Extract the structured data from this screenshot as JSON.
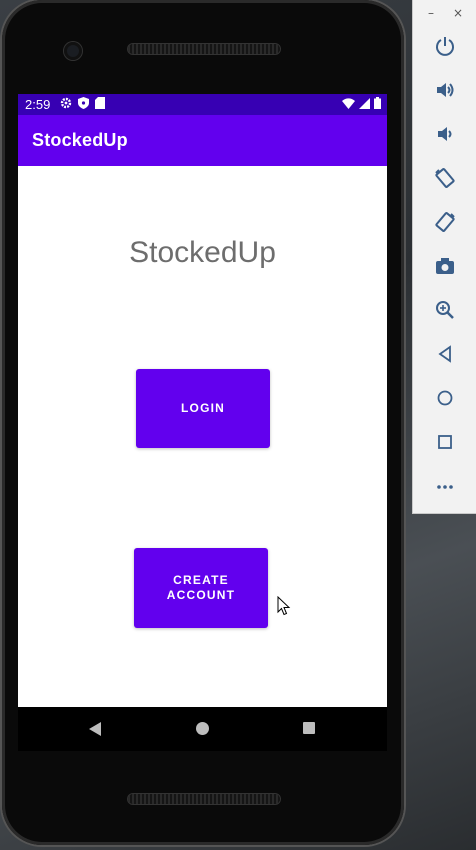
{
  "status_bar": {
    "time": "2:59"
  },
  "app_bar": {
    "title": "StockedUp"
  },
  "main": {
    "app_name": "StockedUp",
    "login_label": "LOGIN",
    "create_label_line1": "CREATE",
    "create_label_line2": "ACCOUNT"
  },
  "colors": {
    "primary": "#6200ee",
    "primary_dark": "#3700b3",
    "text_gray": "#6d6d6d"
  },
  "emulator_panel": {
    "window_controls": [
      "–",
      "×"
    ],
    "tools": [
      "power-icon",
      "volume-up-icon",
      "volume-down-icon",
      "rotate-left-icon",
      "rotate-right-icon",
      "camera-icon",
      "zoom-icon",
      "back-icon",
      "home-icon",
      "overview-icon",
      "more-icon"
    ]
  }
}
